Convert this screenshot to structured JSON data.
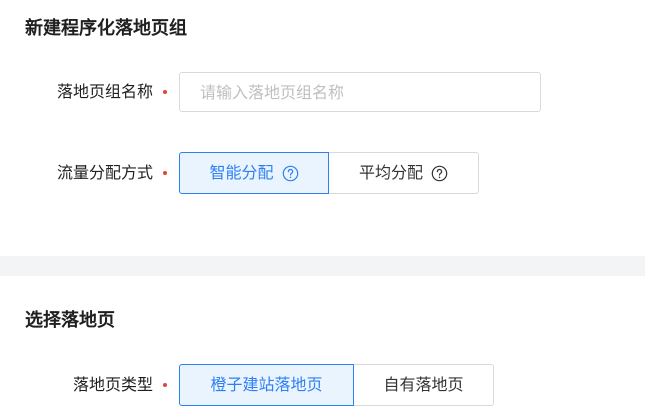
{
  "section1": {
    "title": "新建程序化落地页组",
    "name_field": {
      "label": "落地页组名称",
      "placeholder": "请输入落地页组名称",
      "value": ""
    },
    "traffic_field": {
      "label": "流量分配方式",
      "options": [
        {
          "label": "智能分配",
          "selected": true,
          "icon": "help-circle-icon"
        },
        {
          "label": "平均分配",
          "selected": false,
          "icon": "help-circle-icon"
        }
      ]
    }
  },
  "section2": {
    "title": "选择落地页",
    "type_field": {
      "label": "落地页类型",
      "options": [
        {
          "label": "橙子建站落地页",
          "selected": true
        },
        {
          "label": "自有落地页",
          "selected": false
        }
      ]
    }
  },
  "colors": {
    "accent": "#2f7ff3",
    "accent_bg": "#eaf4ff",
    "required_dot": "#e1463c",
    "divider_bg": "#f3f4f6"
  }
}
